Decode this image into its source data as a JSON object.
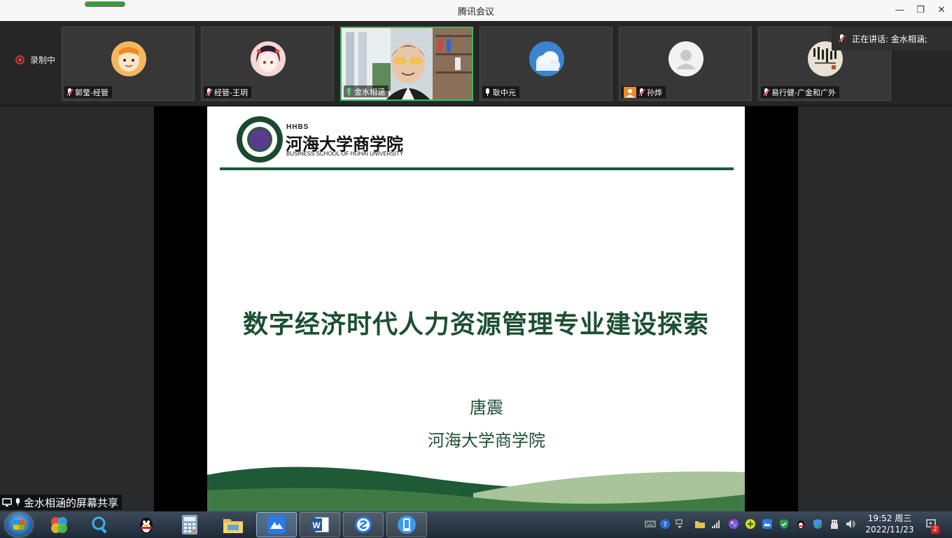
{
  "window": {
    "title": "腾讯会议",
    "controls": {
      "minimize": "—",
      "restore": "❐",
      "close": "✕"
    }
  },
  "recording": {
    "label": "录制中"
  },
  "participants": [
    {
      "name": "郭莹-经管",
      "mic": "muted",
      "avatar": "cartoon-tiger-icon"
    },
    {
      "name": "经管-王玥",
      "mic": "muted",
      "avatar": "anime-girl-icon"
    },
    {
      "name": "金水相涵",
      "mic": "on",
      "avatar": "camera-video",
      "active": true
    },
    {
      "name": "耿中元",
      "mic": "on",
      "avatar": "sky-cloud-icon"
    },
    {
      "name": "孙烨",
      "mic": "muted",
      "avatar": "default-user-icon"
    },
    {
      "name": "易行健-广金和广外",
      "mic": "muted",
      "avatar": "calligraphy-icon"
    }
  ],
  "speaking": {
    "text": "正在讲话: 金水相涵;"
  },
  "slide": {
    "brand_short": "HHBS",
    "brand_cn": "河海大学商学院",
    "brand_en": "BUSINESS SCHOOL OF HOHAI UNIVERSITY",
    "title": "数字经济时代人力资源管理专业建设探索",
    "author": "唐震",
    "institution": "河海大学商学院"
  },
  "share": {
    "label": "金水相涵的屏幕共享"
  },
  "taskbar": {
    "apps": [
      "start-icon",
      "color-balls-icon",
      "search-icon",
      "qq-penguin-icon",
      "calculator-icon",
      "file-manager-icon",
      "tencent-meeting-icon",
      "word-icon",
      "sogou-icon",
      "phone-icon"
    ],
    "clock_time": "19:52 周三",
    "clock_date": "2022/11/23",
    "notification_count": "2"
  },
  "colors": {
    "slide_green": "#1d4f32",
    "active_border": "#3cba5e",
    "muted_red": "#e04646"
  }
}
